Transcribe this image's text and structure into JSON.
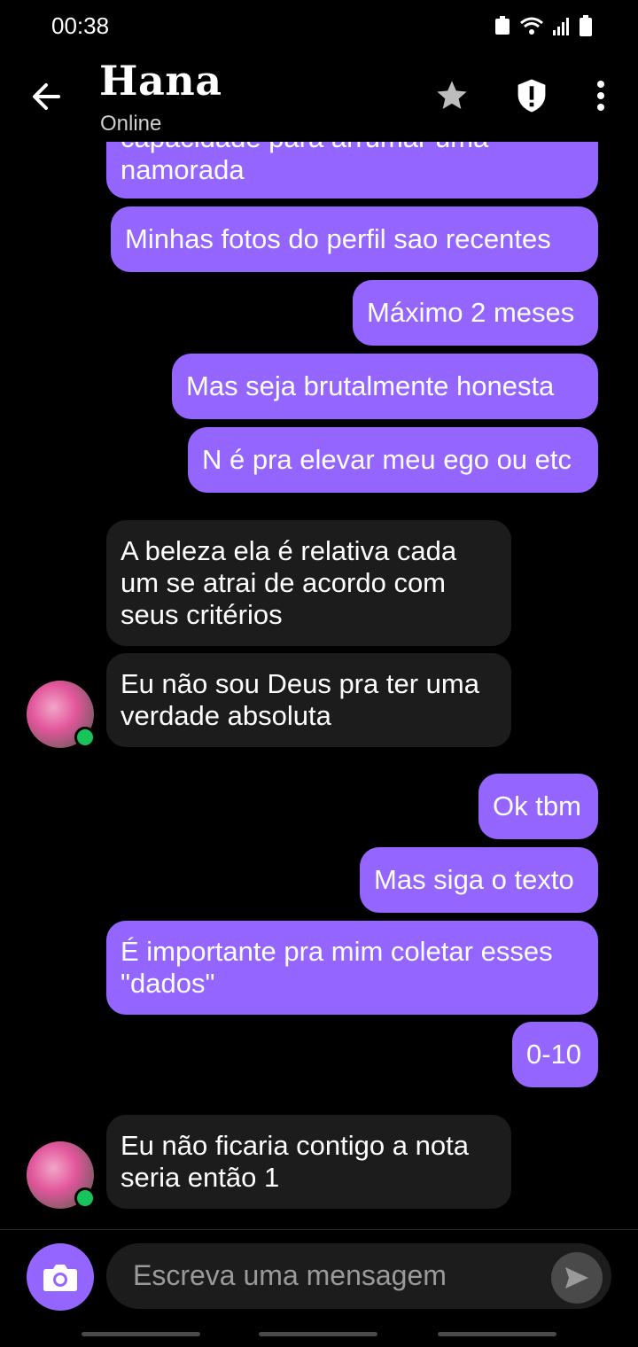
{
  "status_bar": {
    "time": "00:38"
  },
  "header": {
    "contact_name": "Hana",
    "presence": "Online"
  },
  "messages": [
    {
      "dir": "out",
      "text": "capacidade para arrumar uma namorada"
    },
    {
      "dir": "out",
      "text": "Minhas fotos do perfil sao recentes"
    },
    {
      "dir": "out",
      "text": "Máximo 2 meses"
    },
    {
      "dir": "out",
      "text": "Mas seja brutalmente honesta"
    },
    {
      "dir": "out",
      "text": "N é pra elevar meu ego ou etc"
    },
    {
      "dir": "in",
      "text": "A beleza ela é relativa cada um se atrai de acordo com seus critérios"
    },
    {
      "dir": "in",
      "text": "Eu não sou Deus pra ter uma verdade absoluta"
    },
    {
      "dir": "out",
      "text": "Ok tbm"
    },
    {
      "dir": "out",
      "text": "Mas siga o texto"
    },
    {
      "dir": "out",
      "text": "É importante pra mim coletar esses \"dados\""
    },
    {
      "dir": "out",
      "text": "0-10"
    },
    {
      "dir": "in",
      "text": "Eu não ficaria contigo a nota seria então 1"
    }
  ],
  "composer": {
    "placeholder": "Escreva uma mensagem"
  },
  "icons": {
    "back": "arrow-left-icon",
    "favorite": "star-icon",
    "safety": "shield-icon",
    "menu": "more-vertical-icon",
    "camera": "camera-icon",
    "send": "send-icon"
  },
  "colors": {
    "accent": "#9566ff",
    "incoming": "#1c1c1c",
    "online": "#16c45a"
  }
}
